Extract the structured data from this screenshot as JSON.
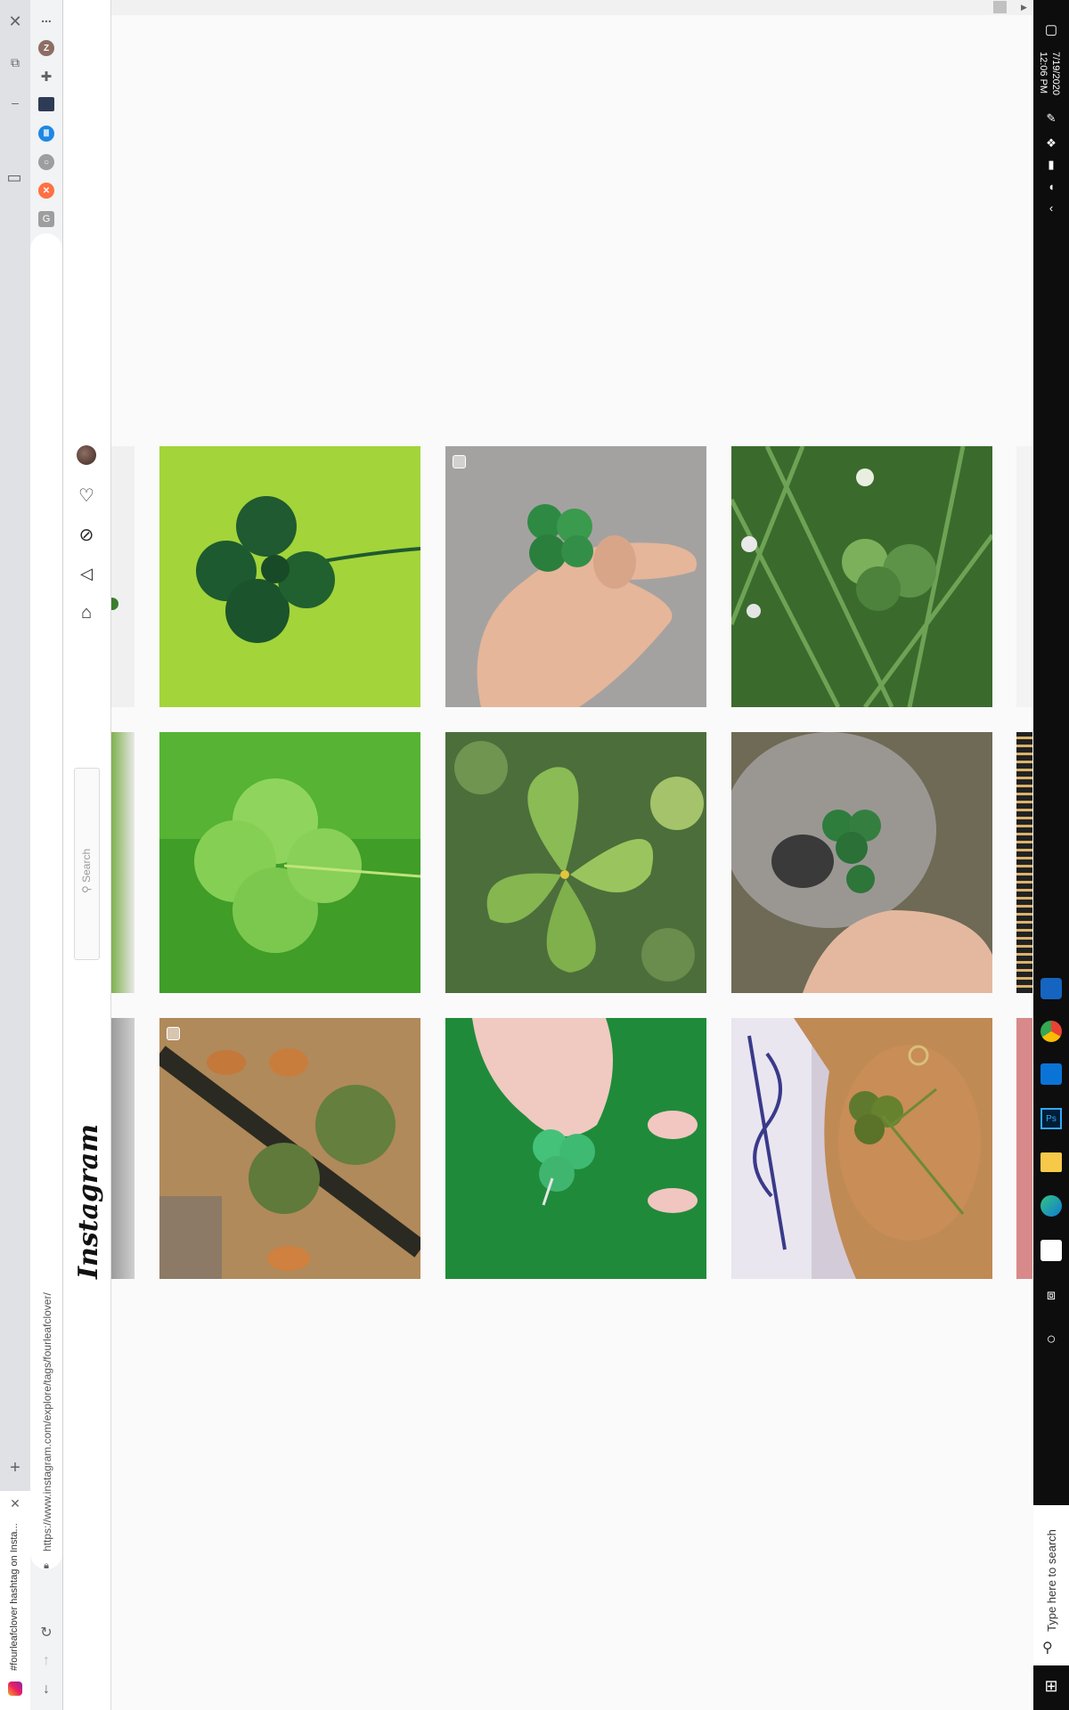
{
  "browser": {
    "tab_title": "#fourleafclover hashtag on Insta...",
    "url": "https://www.instagram.com/explore/tags/fourleafclover/",
    "new_tab_label": "+",
    "more_label": "...",
    "close_label": "×"
  },
  "instagram": {
    "logo_text": "Instagram",
    "search_placeholder": "Search"
  },
  "grid": {
    "tiles": [
      {
        "name": "post-clover-yellow-bg"
      },
      {
        "name": "post-clover-hand-gray"
      },
      {
        "name": "post-clover-grass-flowers"
      },
      {
        "name": "post-clover-green-closeup"
      },
      {
        "name": "post-clover-oxalis"
      },
      {
        "name": "post-clover-pug"
      },
      {
        "name": "post-chickens-yard"
      },
      {
        "name": "post-clover-hand-green"
      },
      {
        "name": "post-clover-palm"
      }
    ]
  },
  "taskbar": {
    "time": "12:06 PM",
    "date": "7/19/2020",
    "search_placeholder": "Type here to search"
  },
  "colors": {
    "instagram_bg": "#fafafa",
    "taskbar_bg": "#0d0d0d",
    "clover_green": "#2f7a3a"
  }
}
